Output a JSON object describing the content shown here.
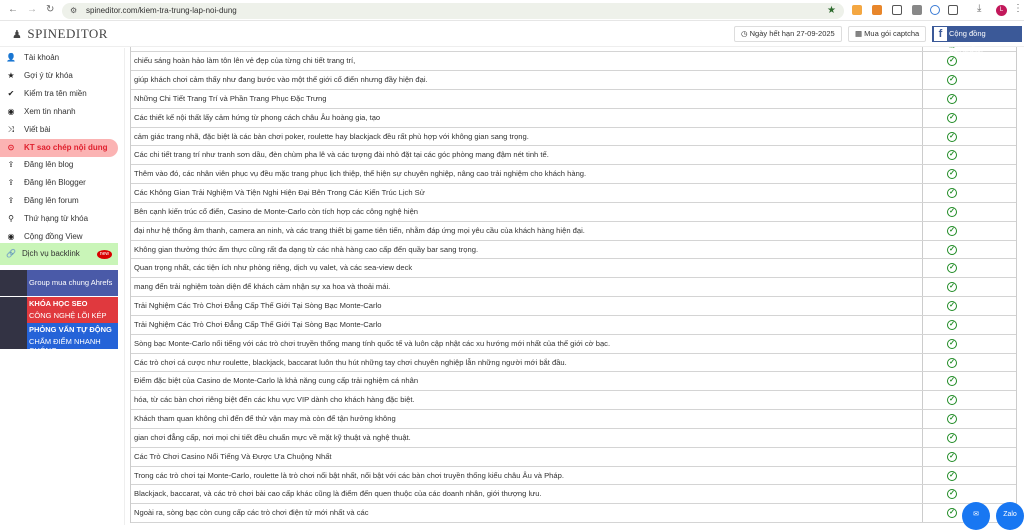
{
  "browser": {
    "url": "spineditor.com/kiem-tra-trung-lap-noi-dung",
    "profile_initial": "L"
  },
  "header": {
    "logo": "SPINEDITOR",
    "expiry": "Ngày hết hạn 27-09-2025",
    "captcha": "Mua gói captcha",
    "community": "Cộng đồng SpinEditor"
  },
  "sidebar": {
    "items": [
      {
        "label": "Tài khoản",
        "icon": "user-icon"
      },
      {
        "label": "Gợi ý từ khóa",
        "icon": "star-icon"
      },
      {
        "label": "Kiểm tra tên miền",
        "icon": "check-icon"
      },
      {
        "label": "Xem tin nhanh",
        "icon": "eye-icon"
      },
      {
        "label": "Viết bài",
        "icon": "shuffle-icon"
      },
      {
        "label": "KT sao chép nội dung",
        "icon": "target-icon",
        "active": true
      },
      {
        "label": "Đăng lên blog",
        "icon": "upload-icon"
      },
      {
        "label": "Đăng lên Blogger",
        "icon": "upload-icon"
      },
      {
        "label": "Đăng lên forum",
        "icon": "upload-icon"
      },
      {
        "label": "Thứ hạng từ khóa",
        "icon": "search-icon"
      },
      {
        "label": "Cộng đồng View",
        "icon": "eye-icon"
      }
    ],
    "backlink": "Dịch vụ backlink",
    "new_badge": "new",
    "banners": [
      {
        "line1": "Group mua chung Ahrefs",
        "thumb": "ahrefs"
      },
      {
        "line1": "KHÓA HỌC SEO",
        "line2": "CÔNG NGHỆ LÕI KÉP"
      },
      {
        "line1": "PHỎNG VẤN TỰ ĐỘNG",
        "line2": "CHẤM ĐIỂM NHANH CHÓNG"
      }
    ]
  },
  "rows": [
    "không gian mở, ánh sáng tự nhiên xuyên qua các cửa sổ lớn và hệ thống",
    "chiếu sáng hoàn hảo làm tôn lên vẻ đẹp của từng chi tiết trang trí,",
    "giúp khách chơi cảm thấy như đang bước vào một thế giới cổ điển nhưng đầy hiện đại.",
    "Những Chi Tiết Trang Trí và Phần Trang Phục Đặc Trưng",
    "Các thiết kế nội thất lấy cảm hứng từ phong cách châu Âu hoàng gia, tạo",
    "cảm giác trang nhã, đặc biệt là các bàn chơi poker, roulette hay blackjack đều rất phù hợp với không gian sang trọng.",
    "Các chi tiết trang trí như tranh sơn dầu, đèn chùm pha lê và các tượng đài nhỏ đặt tại các góc phòng mang đậm nét tinh tế.",
    "Thêm vào đó, các nhân viên phục vụ đều mặc trang phục lịch thiệp, thể hiện sự chuyên nghiệp, nâng cao trải nghiệm cho khách hàng.",
    "Các Không Gian Trải Nghiệm Và Tiện Nghi Hiện Đại Bên Trong Các Kiến Trúc Lịch Sử",
    "Bên cạnh kiến trúc cổ điển, Casino de Monte-Carlo còn tích hợp các công nghệ hiện",
    "đại như hệ thống âm thanh, camera an ninh, và các trang thiết bị game tiên tiến, nhằm đáp ứng mọi yêu cầu của khách hàng hiện đại.",
    "Không gian thưởng thức ẩm thực cũng rất đa dạng từ các nhà hàng cao cấp đến quầy bar sang trọng.",
    "Quan trọng nhất, các tiện ích như phòng riêng, dịch vụ valet, và các sea-view deck",
    "mang đến trải nghiệm toàn diện để khách cảm nhận sự xa hoa và thoải mái.",
    "Trải Nghiệm Các Trò Chơi Đẳng Cấp Thế Giới Tại Sòng Bạc Monte-Carlo",
    "Trải Nghiệm Các Trò Chơi Đẳng Cấp Thế Giới Tại Sòng Bạc Monte-Carlo",
    "Sòng bạc Monte-Carlo nổi tiếng với các trò chơi truyền thống mang tính quốc tế và luôn cập nhật các xu hướng mới nhất của thế giới cờ bạc.",
    "Các trò chơi cá cược như roulette, blackjack, baccarat luôn thu hút những tay chơi chuyên nghiệp lẫn những người mới bắt đầu.",
    "Điểm đặc biệt của Casino de Monte-Carlo là khả năng cung cấp trải nghiệm cá nhân",
    "hóa, từ các bàn chơi riêng biệt đến các khu vực VIP dành cho khách hàng đặc biệt.",
    "Khách tham quan không chỉ đến để thử vận may mà còn để tận hưởng không",
    "gian chơi đẳng cấp, nơi mọi chi tiết đều chuẩn mực về mặt kỹ thuật và nghệ thuật.",
    "Các Trò Chơi Casino Nổi Tiếng Và Được Ưa Chuộng Nhất",
    "Trong các trò chơi tại Monte-Carlo, roulette là trò chơi nổi bật nhất, nổi bật với các bàn chơi truyền thống kiểu châu Âu và Pháp.",
    "Blackjack, baccarat, và các trò chơi bài cao cấp khác cũng là điểm đến quen thuộc của các doanh nhân, giới thượng lưu.",
    "Ngoài ra, sòng bạc còn cung cấp các trò chơi điện tử mới nhất và các"
  ],
  "chat": {
    "messenger": "messenger-icon",
    "zalo": "Zalo"
  },
  "colors": {
    "active": "#e0202e",
    "check": "#1f8b24",
    "facebook": "#3b5998"
  }
}
